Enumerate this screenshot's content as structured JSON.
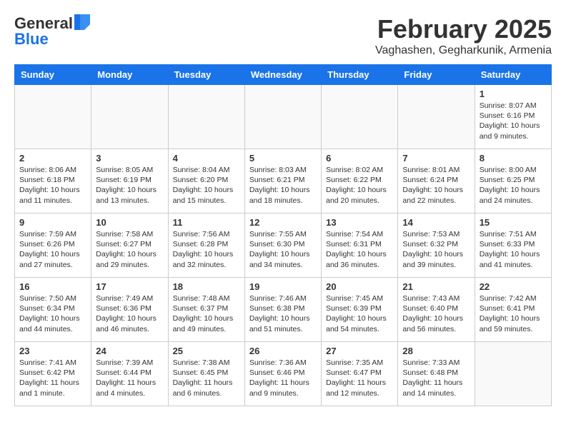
{
  "header": {
    "logo_general": "General",
    "logo_blue": "Blue",
    "month": "February 2025",
    "location": "Vaghashen, Gegharkunik, Armenia"
  },
  "weekdays": [
    "Sunday",
    "Monday",
    "Tuesday",
    "Wednesday",
    "Thursday",
    "Friday",
    "Saturday"
  ],
  "weeks": [
    [
      {
        "day": "",
        "info": ""
      },
      {
        "day": "",
        "info": ""
      },
      {
        "day": "",
        "info": ""
      },
      {
        "day": "",
        "info": ""
      },
      {
        "day": "",
        "info": ""
      },
      {
        "day": "",
        "info": ""
      },
      {
        "day": "1",
        "info": "Sunrise: 8:07 AM\nSunset: 6:16 PM\nDaylight: 10 hours and 9 minutes."
      }
    ],
    [
      {
        "day": "2",
        "info": "Sunrise: 8:06 AM\nSunset: 6:18 PM\nDaylight: 10 hours and 11 minutes."
      },
      {
        "day": "3",
        "info": "Sunrise: 8:05 AM\nSunset: 6:19 PM\nDaylight: 10 hours and 13 minutes."
      },
      {
        "day": "4",
        "info": "Sunrise: 8:04 AM\nSunset: 6:20 PM\nDaylight: 10 hours and 15 minutes."
      },
      {
        "day": "5",
        "info": "Sunrise: 8:03 AM\nSunset: 6:21 PM\nDaylight: 10 hours and 18 minutes."
      },
      {
        "day": "6",
        "info": "Sunrise: 8:02 AM\nSunset: 6:22 PM\nDaylight: 10 hours and 20 minutes."
      },
      {
        "day": "7",
        "info": "Sunrise: 8:01 AM\nSunset: 6:24 PM\nDaylight: 10 hours and 22 minutes."
      },
      {
        "day": "8",
        "info": "Sunrise: 8:00 AM\nSunset: 6:25 PM\nDaylight: 10 hours and 24 minutes."
      }
    ],
    [
      {
        "day": "9",
        "info": "Sunrise: 7:59 AM\nSunset: 6:26 PM\nDaylight: 10 hours and 27 minutes."
      },
      {
        "day": "10",
        "info": "Sunrise: 7:58 AM\nSunset: 6:27 PM\nDaylight: 10 hours and 29 minutes."
      },
      {
        "day": "11",
        "info": "Sunrise: 7:56 AM\nSunset: 6:28 PM\nDaylight: 10 hours and 32 minutes."
      },
      {
        "day": "12",
        "info": "Sunrise: 7:55 AM\nSunset: 6:30 PM\nDaylight: 10 hours and 34 minutes."
      },
      {
        "day": "13",
        "info": "Sunrise: 7:54 AM\nSunset: 6:31 PM\nDaylight: 10 hours and 36 minutes."
      },
      {
        "day": "14",
        "info": "Sunrise: 7:53 AM\nSunset: 6:32 PM\nDaylight: 10 hours and 39 minutes."
      },
      {
        "day": "15",
        "info": "Sunrise: 7:51 AM\nSunset: 6:33 PM\nDaylight: 10 hours and 41 minutes."
      }
    ],
    [
      {
        "day": "16",
        "info": "Sunrise: 7:50 AM\nSunset: 6:34 PM\nDaylight: 10 hours and 44 minutes."
      },
      {
        "day": "17",
        "info": "Sunrise: 7:49 AM\nSunset: 6:36 PM\nDaylight: 10 hours and 46 minutes."
      },
      {
        "day": "18",
        "info": "Sunrise: 7:48 AM\nSunset: 6:37 PM\nDaylight: 10 hours and 49 minutes."
      },
      {
        "day": "19",
        "info": "Sunrise: 7:46 AM\nSunset: 6:38 PM\nDaylight: 10 hours and 51 minutes."
      },
      {
        "day": "20",
        "info": "Sunrise: 7:45 AM\nSunset: 6:39 PM\nDaylight: 10 hours and 54 minutes."
      },
      {
        "day": "21",
        "info": "Sunrise: 7:43 AM\nSunset: 6:40 PM\nDaylight: 10 hours and 56 minutes."
      },
      {
        "day": "22",
        "info": "Sunrise: 7:42 AM\nSunset: 6:41 PM\nDaylight: 10 hours and 59 minutes."
      }
    ],
    [
      {
        "day": "23",
        "info": "Sunrise: 7:41 AM\nSunset: 6:42 PM\nDaylight: 11 hours and 1 minute."
      },
      {
        "day": "24",
        "info": "Sunrise: 7:39 AM\nSunset: 6:44 PM\nDaylight: 11 hours and 4 minutes."
      },
      {
        "day": "25",
        "info": "Sunrise: 7:38 AM\nSunset: 6:45 PM\nDaylight: 11 hours and 6 minutes."
      },
      {
        "day": "26",
        "info": "Sunrise: 7:36 AM\nSunset: 6:46 PM\nDaylight: 11 hours and 9 minutes."
      },
      {
        "day": "27",
        "info": "Sunrise: 7:35 AM\nSunset: 6:47 PM\nDaylight: 11 hours and 12 minutes."
      },
      {
        "day": "28",
        "info": "Sunrise: 7:33 AM\nSunset: 6:48 PM\nDaylight: 11 hours and 14 minutes."
      },
      {
        "day": "",
        "info": ""
      }
    ]
  ]
}
